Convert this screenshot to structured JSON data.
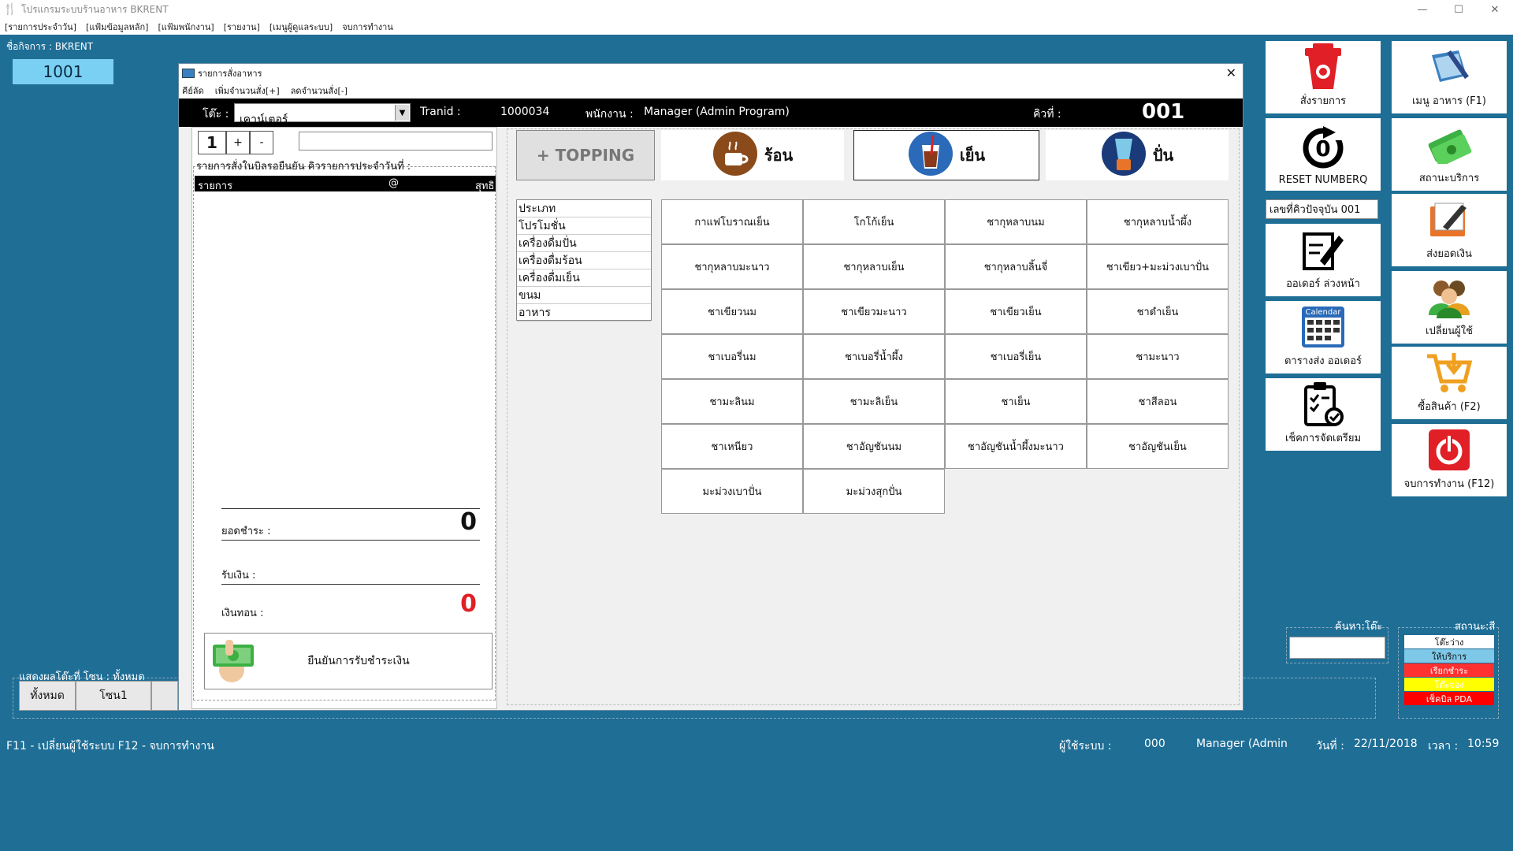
{
  "app": {
    "title": "โปรแกรมระบบร้านอาหาร BKRENT",
    "menu": [
      "[รายการประจำวัน]",
      "[แฟ้มข้อมูลหลัก]",
      "[แฟ้มพนักงาน]",
      "[รายงาน]",
      "[เมนูผู้ดูแลระบบ]",
      "จบการทำงาน"
    ]
  },
  "business": "ชื่อกิจการ : BKRENT",
  "table_number": "1001",
  "dialog": {
    "title": "รายการสั่งอาหาร",
    "menu": [
      "คีย์ลัด",
      "เพิ่มจำนวนสั่ง[+]",
      "ลดจำนวนสั่ง[-]"
    ],
    "table_label": "โต๊ะ :",
    "table_value": "เคาน์เตอร์",
    "tranid_label": "Tranid :",
    "tranid_value": "1000034",
    "staff_label": "พนักงาน :",
    "staff_value": "Manager (Admin Program)",
    "queue_label": "คิวที่ :",
    "queue_value": "001",
    "qty": "1",
    "plus": "+",
    "minus": "-",
    "order_list_label": "รายการสั่งในบิลรอยืนยัน คิวรายการประจำวันที่ :",
    "columns": {
      "item": "รายการ",
      "at": "@",
      "net": "สุทธิ"
    },
    "total_label": "ยอดชำระ :",
    "total_value": "0",
    "received_label": "รับเงิน :",
    "change_label": "เงินทอน :",
    "change_value": "0",
    "confirm_label": "ยืนยันการรับชำระเงิน",
    "topping_label": "+ TOPPING",
    "categories_top": {
      "hot": "ร้อน",
      "cold": "เย็น",
      "blend": "ปั่น"
    },
    "categories": [
      "ประเภท",
      "โปรโมชั่น",
      "เครื่องดื่มปั่น",
      "เครื่องดื่มร้อน",
      "เครื่องดื่มเย็น",
      "ขนม",
      "อาหาร"
    ],
    "items": [
      "กาแฟโบราณเย็น",
      "โกโก้เย็น",
      "ชากุหลาบนม",
      "ชากุหลาบน้ำผึ้ง",
      "ชากุหลาบมะนาว",
      "ชากุหลาบเย็น",
      "ชากุหลาบลิ้นจี่",
      "ชาเขียว+มะม่วงเบาปั่น",
      "ชาเขียวนม",
      "ชาเขียวมะนาว",
      "ชาเขียวเย็น",
      "ชาดำเย็น",
      "ชาเบอรี่นม",
      "ชาเบอรี่น้ำผึ้ง",
      "ชาเบอรี่เย็น",
      "ชามะนาว",
      "ชามะลินม",
      "ชามะลิเย็น",
      "ชาเย็น",
      "ชาสีลอน",
      "ชาเหนียว",
      "ชาอัญชันนม",
      "ชาอัญชันน้ำผึ้งมะนาว",
      "ชาอัญชันเย็น",
      "มะม่วงเบาปั่น",
      "มะม่วงสุกปั่น"
    ]
  },
  "tiles": {
    "order": "สั่งรายการ",
    "food_menu": "เมนู อาหาร  (F1)",
    "reset": "RESET NUMBERQ",
    "service_status": "สถานะบริการ",
    "current_queue": "เลขที่คิวปัจจุบัน 001",
    "send_total": "ส่งยอดเงิน",
    "preorder": "ออเดอร์ ล่วงหน้า",
    "change_user": "เปลี่ยนผู้ใช้",
    "schedule": "ตารางส่ง ออเดอร์",
    "calendar": "Calendar",
    "buy": "ซื้อสินค้า (F2)",
    "check": "เช็คการจัดเตรียม",
    "exit": "จบการทำงาน (F12)"
  },
  "zone": {
    "label": "แสดงผลโต๊ะที่  โซน : ทั้งหมด",
    "all": "ทั้งหมด",
    "zone1": "โซน1"
  },
  "search_label": "ค้นหา:โต๊ะ",
  "status": {
    "label": "สถานะ:สี",
    "items": [
      "โต๊ะว่าง",
      "ให้บริการ",
      "เรียกชำระ",
      "โต๊ะจอง",
      "เช็คบิล PDA"
    ],
    "colors": [
      "#ffffff",
      "#7ec8e8",
      "#ff3030",
      "#ffff00",
      "#ff0000"
    ]
  },
  "footer": {
    "shortcuts": "F11 - เปลี่ยนผู้ใช้ระบบ    F12 - จบการทำงาน",
    "user_label": "ผู้ใช้ระบบ :",
    "user_id": "000",
    "user_name": "Manager (Admin",
    "date_label": "วันที่ :",
    "date_value": "22/11/2018",
    "time_label": "เวลา :",
    "time_value": "10:59"
  }
}
